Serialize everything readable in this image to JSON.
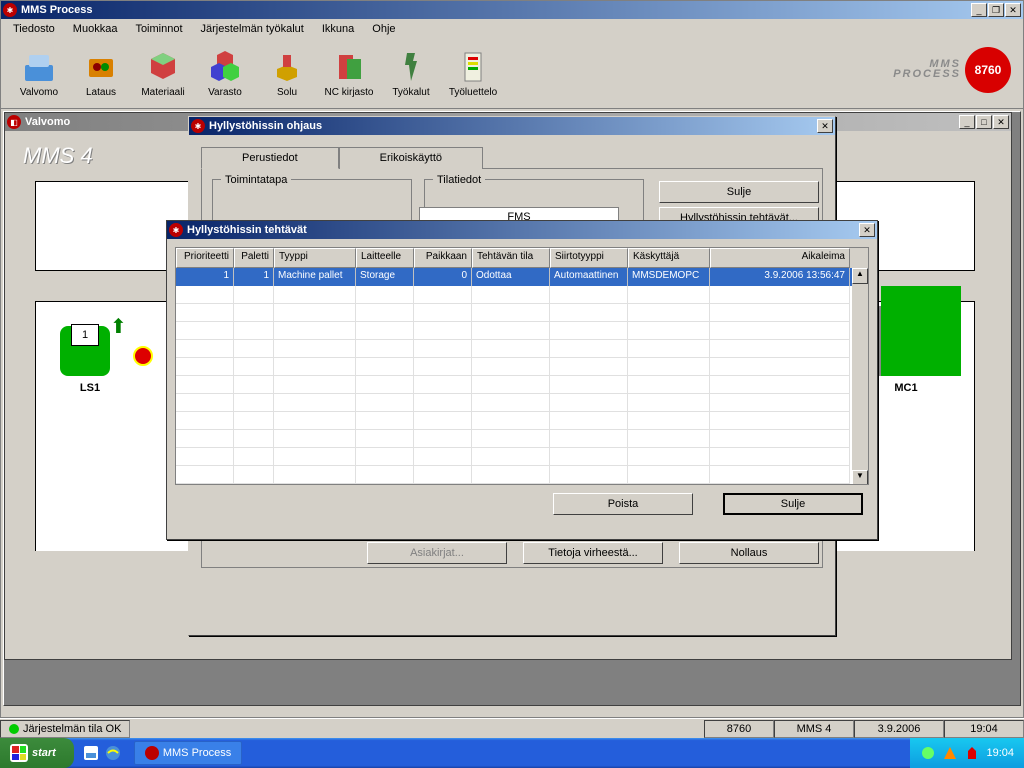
{
  "app": {
    "title": "MMS Process"
  },
  "menu": {
    "items": [
      "Tiedosto",
      "Muokkaa",
      "Toiminnot",
      "Järjestelmän työkalut",
      "Ikkuna",
      "Ohje"
    ]
  },
  "toolbar": {
    "items": [
      "Valvomo",
      "Lataus",
      "Materiaali",
      "Varasto",
      "Solu",
      "NC kirjasto",
      "Työkalut",
      "Työluettelo"
    ]
  },
  "brand": {
    "line1": "MMS",
    "line2": "PROCESS",
    "logo": "8760"
  },
  "valvomo": {
    "title": "Valvomo",
    "mms4": "MMS 4",
    "ls1": "LS1",
    "ls1_num": "1",
    "mc1": "MC1"
  },
  "ohjaus": {
    "title": "Hyllystöhissin ohjaus",
    "tabs": {
      "perustiedot": "Perustiedot",
      "erikoiskaytto": "Erikoiskäyttö"
    },
    "toimintatapa": "Toimintatapa",
    "tilatiedot": "Tilatiedot",
    "fms": "FMS",
    "sulje": "Sulje",
    "tehtavat_btn": "Hyllystöhissin tehtävät...",
    "asiakirjat": "Asiakirjat...",
    "tietoja": "Tietoja virheestä...",
    "nollaus": "Nollaus"
  },
  "tehtavat": {
    "title": "Hyllystöhissin tehtävät",
    "columns": [
      "Prioriteetti",
      "Paletti",
      "Tyyppi",
      "Laitteelle",
      "Paikkaan",
      "Tehtävän tila",
      "Siirtotyyppi",
      "Käskyttäjä",
      "Aikaleima"
    ],
    "row": {
      "prioriteetti": "1",
      "paletti": "1",
      "tyyppi": "Machine pallet",
      "laitteelle": "Storage",
      "paikkaan": "0",
      "tila": "Odottaa",
      "siirto": "Automaattinen",
      "kaskyttaja": "MMSDEMOPC",
      "aikaleima": "3.9.2006 13:56:47"
    },
    "poista": "Poista",
    "sulje": "Sulje"
  },
  "status": {
    "tila": "Järjestelmän tila OK",
    "num": "8760",
    "mms": "MMS 4",
    "date": "3.9.2006",
    "time": "19:04"
  },
  "taskbar": {
    "start": "start",
    "app": "MMS Process",
    "clock": "19:04"
  }
}
